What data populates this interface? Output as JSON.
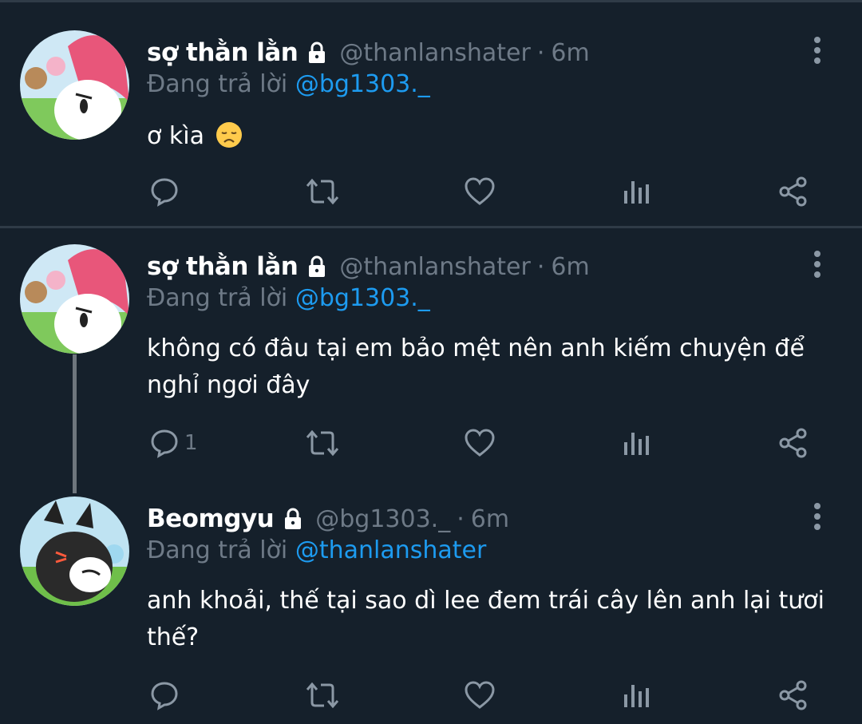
{
  "tweets": [
    {
      "name": "sợ thằn lằn",
      "handle": "@thanlanshater",
      "dot": "·",
      "time": "6m",
      "reply_prefix": "Đang trả lời ",
      "reply_mention": "@bg1303._",
      "text": "ơ kìa",
      "emoji": "disappointed-face",
      "reply_count": ""
    },
    {
      "name": "sợ thằn lằn",
      "handle": "@thanlanshater",
      "dot": "·",
      "time": "6m",
      "reply_prefix": "Đang trả lời ",
      "reply_mention": "@bg1303._",
      "text": "không có đâu tại em bảo mệt nên anh kiếm chuyện để nghỉ ngơi đây",
      "reply_count": "1"
    },
    {
      "name": "Beomgyu",
      "handle": "@bg1303._",
      "dot": "·",
      "time": "6m",
      "reply_prefix": "Đang trả lời ",
      "reply_mention": "@thanlanshater",
      "text": "anh khoải, thế tại sao dì lee đem trái cây lên anh lại tươi thế?",
      "reply_count": ""
    }
  ],
  "colors": {
    "background": "#15202b",
    "muted": "#6e7a87",
    "mention": "#1d9bf0",
    "divider": "#2f3b47"
  },
  "icons": [
    "lock-icon",
    "more-vertical-icon",
    "reply-icon",
    "retweet-icon",
    "like-icon",
    "analytics-icon",
    "share-icon"
  ]
}
